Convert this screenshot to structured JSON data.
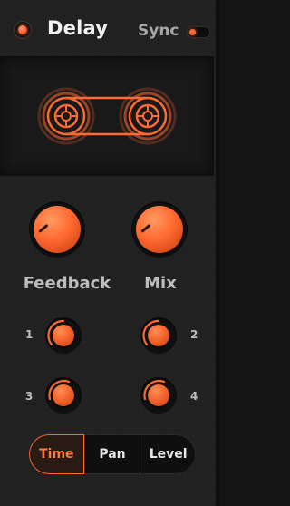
{
  "header": {
    "title": "Delay",
    "sync_label": "Sync",
    "power_on": true,
    "sync_on": true
  },
  "display": {
    "icon": "tape-reel-icon"
  },
  "knobs": {
    "feedback": {
      "label": "Feedback"
    },
    "mix": {
      "label": "Mix"
    },
    "tap1": {
      "label": "1"
    },
    "tap2": {
      "label": "2"
    },
    "tap3": {
      "label": "3"
    },
    "tap4": {
      "label": "4"
    }
  },
  "tabs": [
    {
      "label": "Time",
      "active": true
    },
    {
      "label": "Pan",
      "active": false
    },
    {
      "label": "Level",
      "active": false
    }
  ],
  "colors": {
    "accent": "#ff6a33",
    "panel": "#202020",
    "text": "#bdbdbd"
  }
}
